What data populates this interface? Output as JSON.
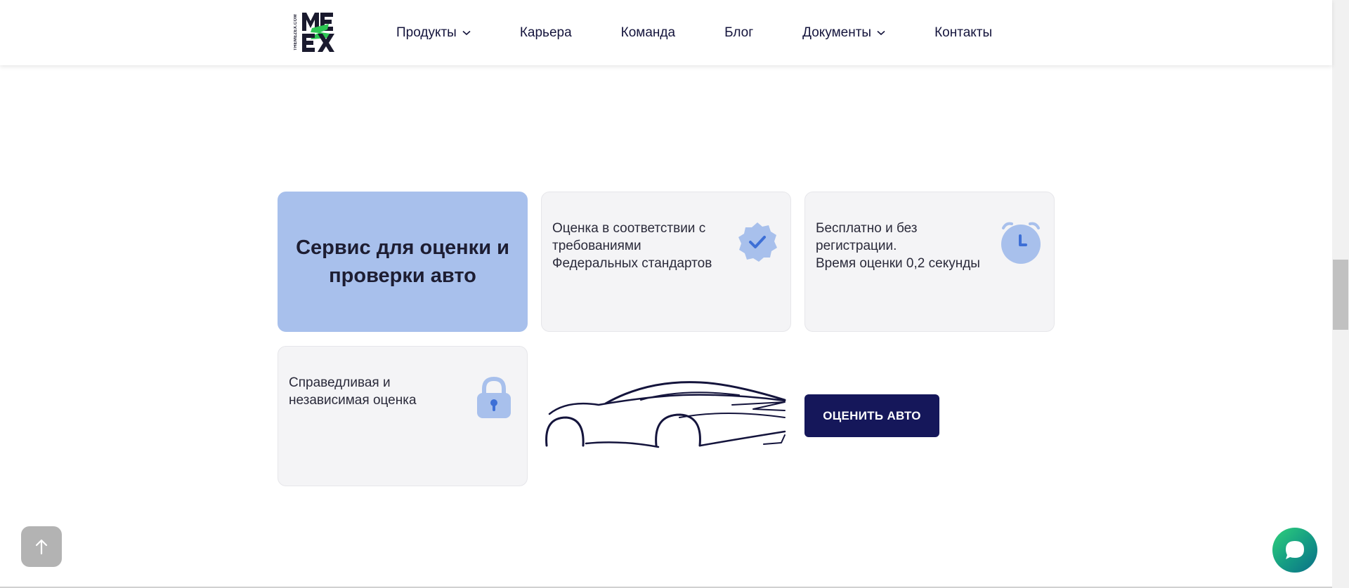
{
  "header": {
    "logo": {
      "vertical_text": "THEMEZEX.COM",
      "mark_letters": "MEZEX",
      "icon": "mezex-logo-icon",
      "colors": {
        "dark": "#1a1a2e",
        "accent": "#2dc653"
      }
    },
    "nav": [
      {
        "label": "Продукты",
        "has_dropdown": true
      },
      {
        "label": "Карьера",
        "has_dropdown": false
      },
      {
        "label": "Команда",
        "has_dropdown": false
      },
      {
        "label": "Блог",
        "has_dropdown": false
      },
      {
        "label": "Документы",
        "has_dropdown": true
      },
      {
        "label": "Контакты",
        "has_dropdown": false
      }
    ]
  },
  "hero": {
    "title": "Сервис для оценки и проверки авто",
    "background": "#a8c0ec"
  },
  "features": [
    {
      "text": "Оценка в соответствии с\nтребованиями\nФедеральных стандартов",
      "icon": "verified-badge-icon"
    },
    {
      "text": "Бесплатно и без\nрегистрации.\nВремя оценки 0,2 секунды",
      "icon": "alarm-clock-icon"
    },
    {
      "text": "Справедливая и\nнезависимая оценка",
      "icon": "padlock-icon"
    }
  ],
  "car_illustration": {
    "icon": "sports-car-outline-icon"
  },
  "cta": {
    "label": "ОЦЕНИТЬ АВТО",
    "color": "#15175a"
  },
  "floating": {
    "scroll_top_icon": "arrow-up-icon",
    "chat_icon": "chat-bubble-icon"
  }
}
